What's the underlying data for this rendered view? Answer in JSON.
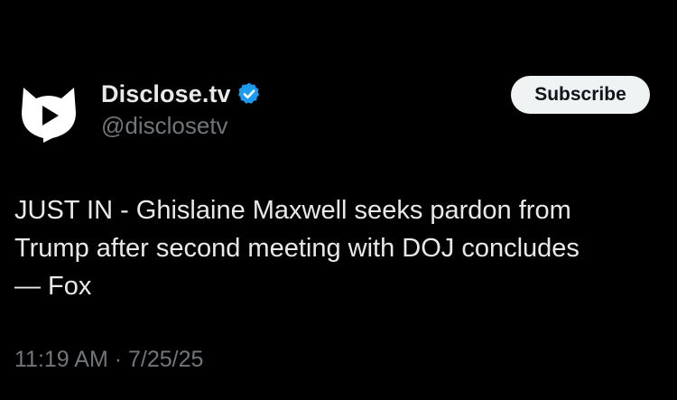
{
  "author": {
    "display_name": "Disclose.tv",
    "handle": "@disclosetv",
    "verified": true,
    "avatar_icon": "disclose-tv-logo-icon",
    "verified_icon": "verified-badge-icon"
  },
  "actions": {
    "subscribe_label": "Subscribe"
  },
  "post": {
    "lines": [
      "JUST IN - Ghislaine Maxwell seeks pardon from",
      "Trump after second meeting with DOJ concludes",
      "— Fox"
    ]
  },
  "meta": {
    "time": "11:19 AM",
    "separator": " · ",
    "date": "7/25/25"
  },
  "colors": {
    "background": "#000000",
    "primary_text": "#e7e9ea",
    "secondary_text": "#71767b",
    "verified_blue": "#1d9bf0",
    "button_bg": "#eff3f4",
    "button_text": "#0f1419"
  }
}
